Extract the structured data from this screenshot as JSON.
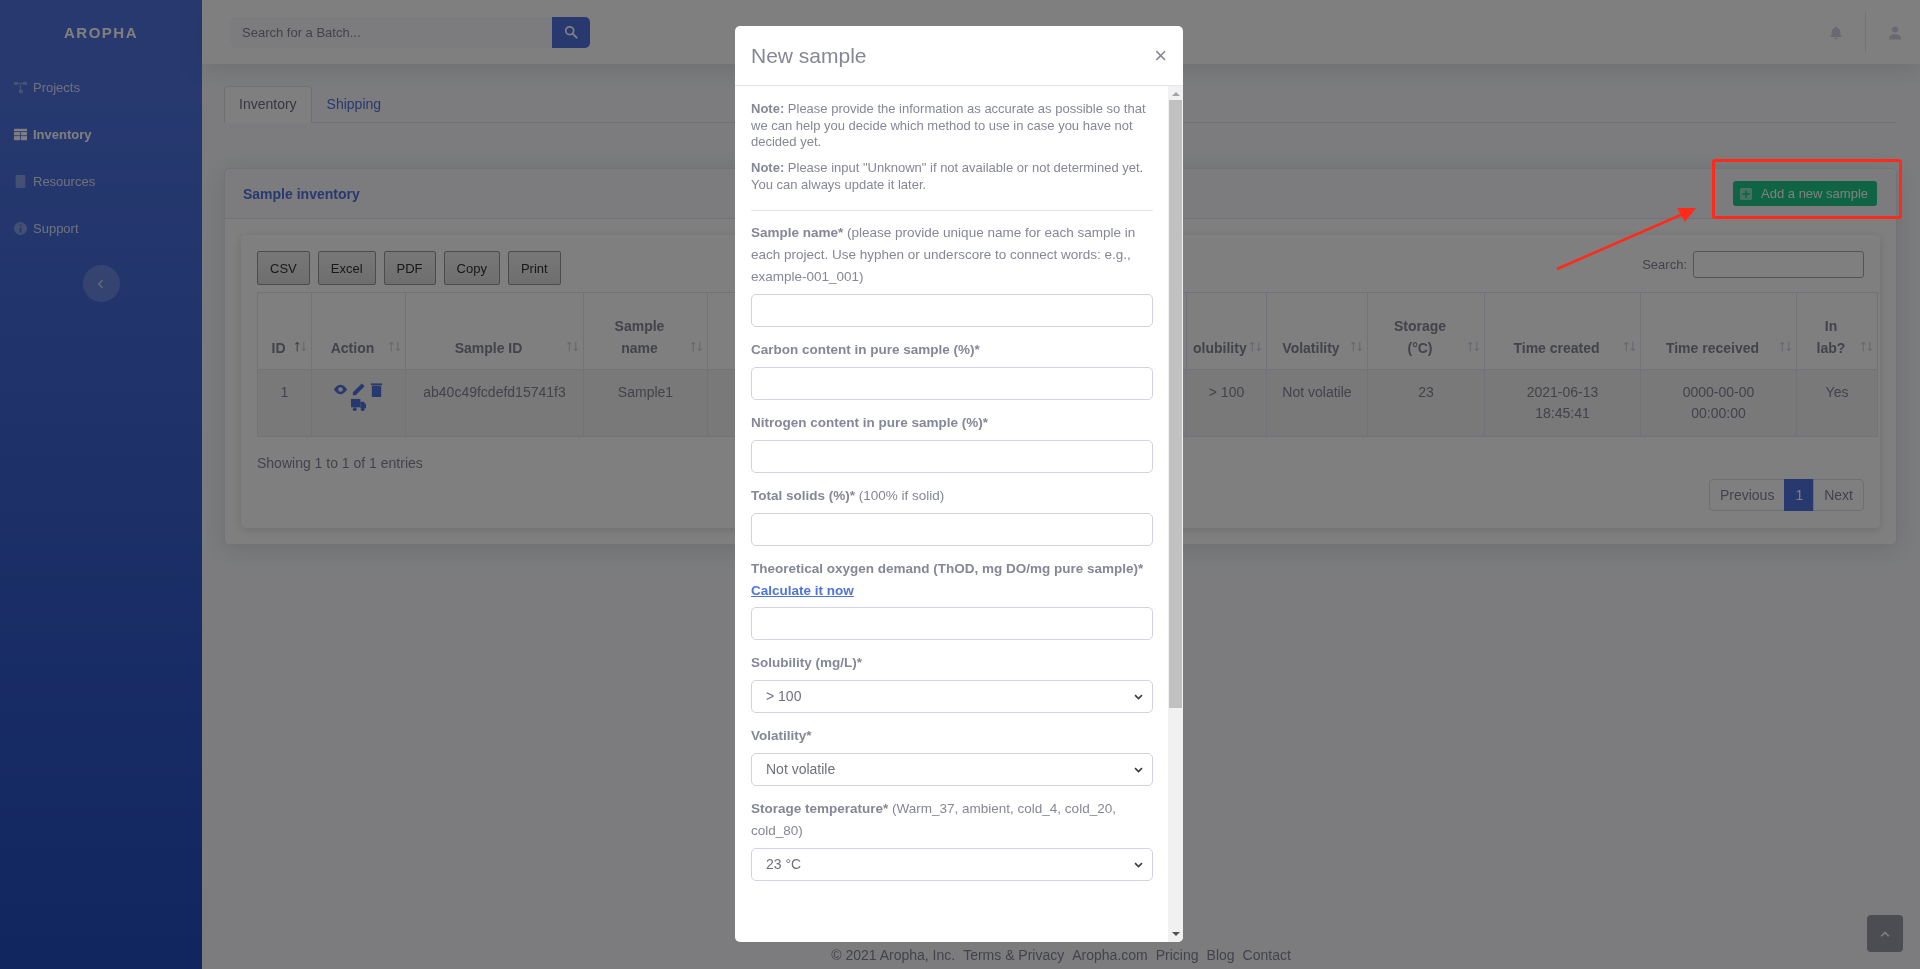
{
  "sidebar": {
    "brand": "AROPHA",
    "items": [
      {
        "label": "Projects",
        "selected": false
      },
      {
        "label": "Inventory",
        "selected": true
      },
      {
        "label": "Resources",
        "selected": false
      },
      {
        "label": "Support",
        "selected": false
      }
    ]
  },
  "topbar": {
    "search": {
      "placeholder": "Search for a Batch..."
    }
  },
  "tabs": [
    {
      "label": "Inventory",
      "selected": true
    },
    {
      "label": "Shipping",
      "selected": false
    }
  ],
  "card": {
    "title": "Sample inventory",
    "add_button": "Add a new sample",
    "export_buttons": [
      "CSV",
      "Excel",
      "PDF",
      "Copy",
      "Print"
    ],
    "search_label": "Search:",
    "table": {
      "columns": [
        {
          "label": "ID",
          "kind": "text",
          "sorted": true
        },
        {
          "label": "Action",
          "kind": "actions",
          "sorted": false
        },
        {
          "label": "Sample ID",
          "kind": "text",
          "sorted": false
        },
        {
          "label": "Sample name",
          "kind": "text",
          "sorted": false
        },
        {
          "label": "olubility",
          "kind": "text",
          "sorted": false
        },
        {
          "label": "Volatility",
          "kind": "text",
          "sorted": false
        },
        {
          "label": "Storage (°C)",
          "kind": "text",
          "sorted": false
        },
        {
          "label": "Time created",
          "kind": "text",
          "sorted": false
        },
        {
          "label": "Time received",
          "kind": "text",
          "sorted": false
        },
        {
          "label": "In lab?",
          "kind": "text",
          "sorted": false
        }
      ],
      "rows": [
        {
          "cells": [
            "1",
            "",
            "ab40c49fcdefd15741f3",
            "Sample1",
            "> 100",
            "Not volatile",
            "23",
            "2021-06-13 18:45:41",
            "0000-00-00 00:00:00",
            "Yes"
          ]
        }
      ]
    },
    "info": "Showing 1 to 1 of 1 entries",
    "pagination": [
      {
        "label": "Previous",
        "selected": false
      },
      {
        "label": "1",
        "selected": true
      },
      {
        "label": "Next",
        "selected": false
      }
    ]
  },
  "footer": {
    "copyright": "© 2021 Aropha, Inc.",
    "links": [
      "Terms & Privacy",
      "Aropha.com",
      "Pricing",
      "Blog",
      "Contact"
    ]
  },
  "modal": {
    "title": "New sample",
    "close": "×",
    "notes": [
      {
        "lead": "Note:",
        "text": "Please provide the information as accurate as possible so that we can help you decide which method to use in case you have not decided yet."
      },
      {
        "lead": "Note:",
        "text": "Please input \"Unknown\" if not available or not determined yet. You can always update it later."
      }
    ],
    "fields": [
      {
        "kind": "input",
        "label": "Sample name*",
        "hint": "(please provide unique name for each sample in each project. Use hyphen or underscore to connect words: e.g., example-001_001)"
      },
      {
        "kind": "input",
        "label": "Carbon content in pure sample (%)*"
      },
      {
        "kind": "input",
        "label": "Nitrogen content in pure sample (%)*"
      },
      {
        "kind": "input",
        "label": "Total solids (%)*",
        "hint": "(100% if solid)"
      },
      {
        "kind": "input",
        "label": "Theoretical oxygen demand (ThOD, mg DO/mg pure sample)*",
        "link": "Calculate it now"
      },
      {
        "kind": "select",
        "label": "Solubility (mg/L)*",
        "value": "> 100"
      },
      {
        "kind": "select",
        "label": "Volatility*",
        "value": "Not volatile"
      },
      {
        "kind": "select",
        "label": "Storage temperature*",
        "hint": "(Warm_37, ambient, cold_4, cold_20, cold_80)",
        "value": "23 °C"
      }
    ]
  }
}
